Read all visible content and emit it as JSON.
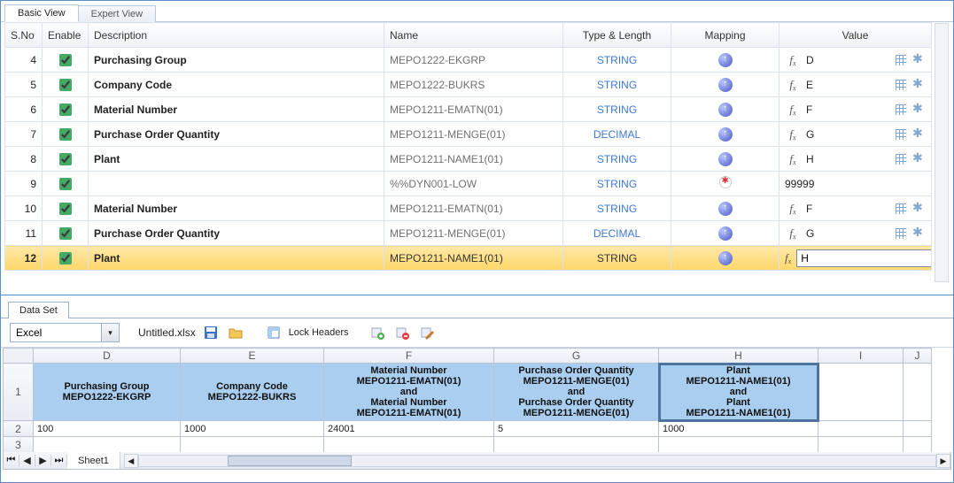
{
  "tabs": {
    "basic": "Basic View",
    "expert": "Expert View"
  },
  "columns": {
    "sno": "S.No",
    "enable": "Enable",
    "desc": "Description",
    "name": "Name",
    "type": "Type & Length",
    "mapping": "Mapping",
    "value": "Value"
  },
  "rows": [
    {
      "sno": "4",
      "enabled": true,
      "desc": "Purchasing Group",
      "name": "MEPO1222-EKGRP",
      "type": "STRING",
      "map": "up",
      "value": "D",
      "selected": false
    },
    {
      "sno": "5",
      "enabled": true,
      "desc": "Company Code",
      "name": "MEPO1222-BUKRS",
      "type": "STRING",
      "map": "up",
      "value": "E",
      "selected": false
    },
    {
      "sno": "6",
      "enabled": true,
      "desc": "Material Number",
      "name": "MEPO1211-EMATN(01)",
      "type": "STRING",
      "map": "up",
      "value": "F",
      "selected": false
    },
    {
      "sno": "7",
      "enabled": true,
      "desc": "Purchase Order Quantity",
      "name": "MEPO1211-MENGE(01)",
      "type": "DECIMAL",
      "map": "up",
      "value": "G",
      "selected": false
    },
    {
      "sno": "8",
      "enabled": true,
      "desc": "Plant",
      "name": "MEPO1211-NAME1(01)",
      "type": "STRING",
      "map": "up",
      "value": "H",
      "selected": false
    },
    {
      "sno": "9",
      "enabled": true,
      "desc": "",
      "name": "%%DYN001-LOW",
      "type": "STRING",
      "map": "err",
      "value": "99999",
      "selected": false,
      "plain": true
    },
    {
      "sno": "10",
      "enabled": true,
      "desc": "Material Number",
      "name": "MEPO1211-EMATN(01)",
      "type": "STRING",
      "map": "up",
      "value": "F",
      "selected": false
    },
    {
      "sno": "11",
      "enabled": true,
      "desc": "Purchase Order Quantity",
      "name": "MEPO1211-MENGE(01)",
      "type": "DECIMAL",
      "map": "up",
      "value": "G",
      "selected": false
    },
    {
      "sno": "12",
      "enabled": true,
      "desc": "Plant",
      "name": "MEPO1211-NAME1(01)",
      "type": "STRING",
      "map": "up",
      "value": "H",
      "selected": true
    }
  ],
  "dataset": {
    "tab": "Data Set",
    "sourceType": "Excel",
    "filename": "Untitled.xlsx",
    "lockHeaders": "Lock Headers",
    "cols": [
      "D",
      "E",
      "F",
      "G",
      "H",
      "I",
      "J"
    ],
    "headers": [
      "Purchasing Group\nMEPO1222-EKGRP",
      "Company Code\nMEPO1222-BUKRS",
      "Material Number\nMEPO1211-EMATN(01)\nand\nMaterial Number\nMEPO1211-EMATN(01)",
      "Purchase Order Quantity\nMEPO1211-MENGE(01)\nand\nPurchase Order Quantity\nMEPO1211-MENGE(01)",
      "Plant\nMEPO1211-NAME1(01)\nand\nPlant\nMEPO1211-NAME1(01)",
      "",
      ""
    ],
    "selectedHeaderIndex": 4,
    "row1Label": "1",
    "row2Label": "2",
    "row2": [
      "100",
      "1000",
      "24001",
      "5",
      "1000",
      "",
      ""
    ],
    "row3Label": "3",
    "sheetName": "Sheet1"
  }
}
